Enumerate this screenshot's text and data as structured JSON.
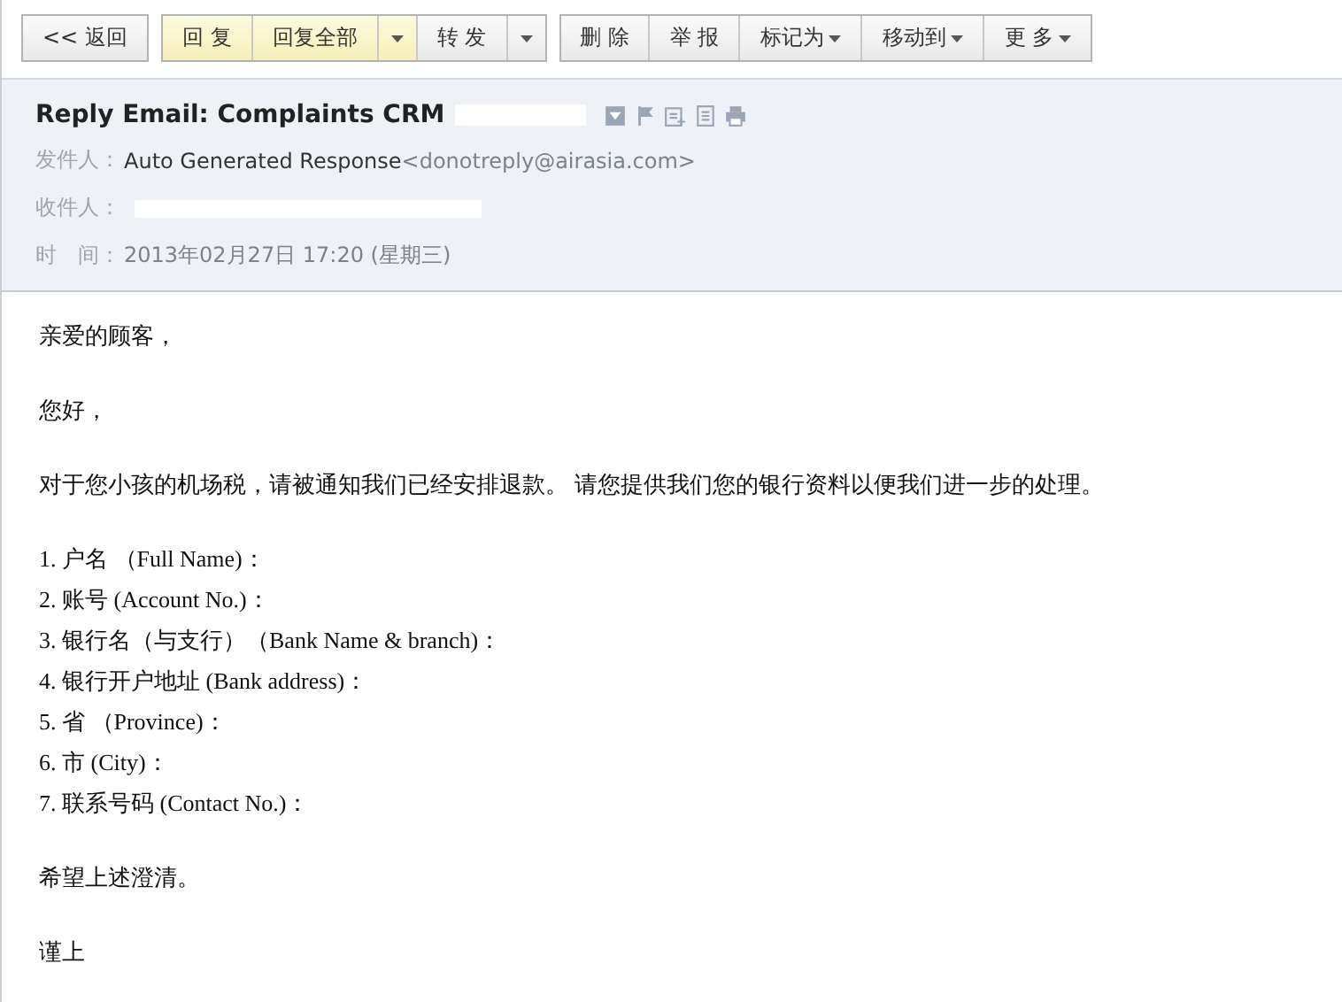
{
  "toolbar": {
    "groups": [
      {
        "buttons": [
          {
            "kind": "button",
            "label": "<< 返回",
            "highlighted": false,
            "caret": false
          }
        ]
      },
      {
        "buttons": [
          {
            "kind": "button",
            "label": "回 复",
            "highlighted": true,
            "caret": false
          },
          {
            "kind": "button",
            "label": "回复全部",
            "highlighted": true,
            "caret": false
          },
          {
            "kind": "arrow",
            "highlighted": true
          },
          {
            "kind": "button",
            "label": "转 发",
            "highlighted": false,
            "caret": false
          },
          {
            "kind": "arrow",
            "highlighted": false
          }
        ]
      },
      {
        "buttons": [
          {
            "kind": "button",
            "label": "删 除",
            "highlighted": false,
            "caret": false
          },
          {
            "kind": "button",
            "label": "举 报",
            "highlighted": false,
            "caret": false
          },
          {
            "kind": "button",
            "label": "标记为",
            "highlighted": false,
            "caret": true
          },
          {
            "kind": "button",
            "label": "移动到",
            "highlighted": false,
            "caret": true
          },
          {
            "kind": "button",
            "label": "更 多",
            "highlighted": false,
            "caret": true
          }
        ]
      }
    ]
  },
  "header": {
    "subject": "Reply Email: Complaints CRM",
    "subject_redacted": true,
    "fields": [
      {
        "label": "发件人：",
        "name": "Auto Generated Response",
        "address": "<donotreply@airasia.com>",
        "redacted": false
      },
      {
        "label": "收件人：",
        "redacted": true
      },
      {
        "label": "时　间：",
        "value": "2013年02月27日 17:20 (星期三)",
        "redacted": false
      }
    ]
  },
  "body": {
    "paragraphs": [
      {
        "lines": [
          "亲爱的顾客，"
        ]
      },
      {
        "lines": [
          "您好，"
        ]
      },
      {
        "lines": [
          "对于您小孩的机场税，请被通知我们已经安排退款。  请您提供我们您的银行资料以便我们进一步的处理。"
        ]
      },
      {
        "lines": [
          "1. 户名 （Full Name)：",
          "2. 账号 (Account No.)：",
          "3. 银行名（与支行）（Bank Name & branch)：",
          "4. 银行开户地址 (Bank address)：",
          "5. 省 （Province)：",
          "6. 市 (City)：",
          "7. 联系号码 (Contact No.)："
        ]
      },
      {
        "lines": [
          "希望上述澄清。"
        ]
      },
      {
        "lines": [
          "谨上"
        ]
      }
    ]
  }
}
